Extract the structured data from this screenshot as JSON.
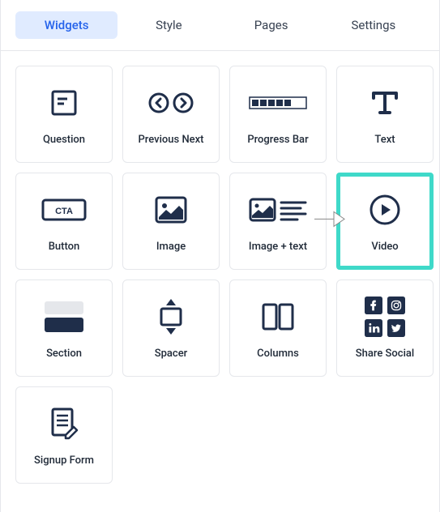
{
  "tabs": {
    "widgets": "Widgets",
    "style": "Style",
    "pages": "Pages",
    "settings": "Settings"
  },
  "widgets": {
    "question": "Question",
    "prev_next": "Previous Next",
    "progress": "Progress Bar",
    "text": "Text",
    "button": "Button",
    "button_cta": "CTA",
    "image": "Image",
    "image_text": "Image + text",
    "video": "Video",
    "section": "Section",
    "spacer": "Spacer",
    "columns": "Columns",
    "share_social": "Share Social",
    "signup_form": "Signup Form"
  }
}
